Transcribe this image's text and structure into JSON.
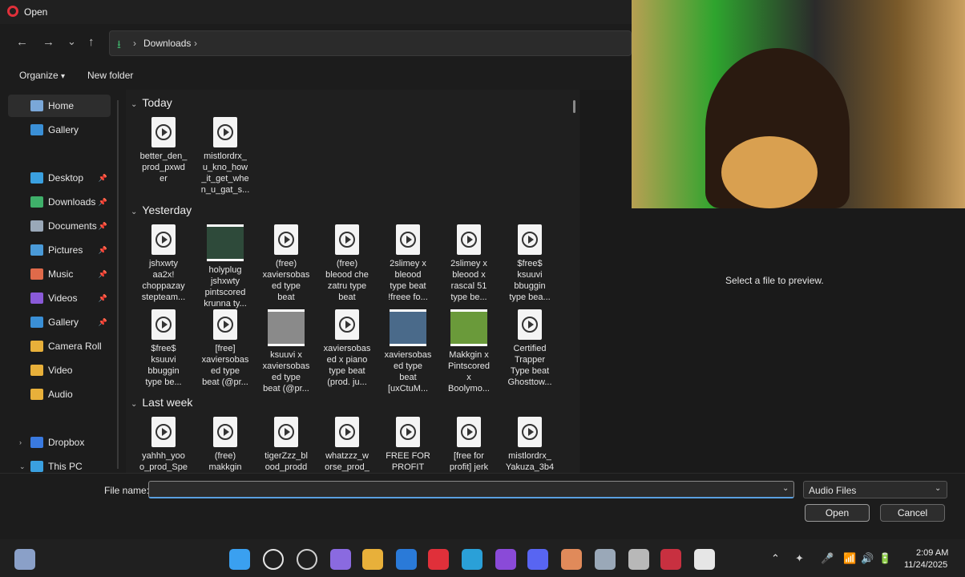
{
  "window": {
    "title": "Open"
  },
  "nav": {
    "back": "←",
    "forward": "→",
    "recent": "⌄",
    "up": "↑"
  },
  "address": {
    "crumbs": [
      "Downloads"
    ],
    "sep": "›"
  },
  "commands": {
    "organize": "Organize",
    "organize_chevron": "▾",
    "new_folder": "New folder"
  },
  "sidebar": {
    "items": [
      {
        "label": "Home",
        "icon": "home-icon",
        "color": "#7aa7d8",
        "selected": true
      },
      {
        "label": "Gallery",
        "icon": "gallery-icon",
        "color": "#3a8fd6"
      },
      {
        "label": "Desktop",
        "icon": "desktop-icon",
        "color": "#3aa0e0",
        "pinned": true
      },
      {
        "label": "Downloads",
        "icon": "download-icon",
        "color": "#3fb06a",
        "pinned": true
      },
      {
        "label": "Documents",
        "icon": "document-icon",
        "color": "#9aa8b8",
        "pinned": true
      },
      {
        "label": "Pictures",
        "icon": "pictures-icon",
        "color": "#4a9ad8",
        "pinned": true
      },
      {
        "label": "Music",
        "icon": "music-icon",
        "color": "#e06a4a",
        "pinned": true
      },
      {
        "label": "Videos",
        "icon": "videos-icon",
        "color": "#8a5ad8",
        "pinned": true
      },
      {
        "label": "Gallery",
        "icon": "gallery-icon",
        "color": "#3a8fd6",
        "pinned": true
      },
      {
        "label": "Camera Roll",
        "icon": "folder-icon",
        "color": "#e8b03a"
      },
      {
        "label": "Video",
        "icon": "folder-icon",
        "color": "#e8b03a"
      },
      {
        "label": "Audio",
        "icon": "folder-icon",
        "color": "#e8b03a"
      },
      {
        "label": "Dropbox",
        "icon": "dropbox-icon",
        "color": "#3a7ae0",
        "expandable": "›"
      },
      {
        "label": "This PC",
        "icon": "pc-icon",
        "color": "#3aa0e0",
        "expandable": "⌄"
      }
    ],
    "pin_glyph": "📌"
  },
  "groups": [
    {
      "label": "Today",
      "files": [
        {
          "name": "better_den_\nprod_pxwd\ner",
          "kind": "audio"
        },
        {
          "name": "mistlordrx_\nu_kno_how\n_it_get_whe\nn_u_gat_s...",
          "kind": "audio"
        }
      ]
    },
    {
      "label": "Yesterday",
      "files": [
        {
          "name": "jshxwty\naa2x!\nchoppazay\nstepteam...",
          "kind": "audio"
        },
        {
          "name": "holyplug\njshxwty\npintscored\nkrunna ty...",
          "kind": "thumb",
          "color": "#2e4a3a"
        },
        {
          "name": "(free)\nxaviersobas\ned type\nbeat",
          "kind": "audio"
        },
        {
          "name": "(free)\nbleood che\nzatru type\nbeat",
          "kind": "audio"
        },
        {
          "name": "2slimey x\nbleood\ntype beat\n!freee fo...",
          "kind": "audio"
        },
        {
          "name": "2slimey x\nbleood x\nrascal 51\ntype be...",
          "kind": "audio"
        },
        {
          "name": "$free$\nksuuvi\nbbuggin\ntype bea...",
          "kind": "audio"
        },
        {
          "name": "$free$\nksuuvi\nbbuggin\ntype be...",
          "kind": "audio"
        },
        {
          "name": "[free]\nxaviersobas\ned type\nbeat (@pr...",
          "kind": "audio"
        },
        {
          "name": "ksuuvi x\nxaviersobas\ned type\nbeat (@pr...",
          "kind": "thumb",
          "color": "#8a8a8a"
        },
        {
          "name": "xaviersobas\ned x piano\ntype beat\n(prod. ju...",
          "kind": "audio"
        },
        {
          "name": "xaviersobas\ned type\nbeat\n[uxCtuM...",
          "kind": "thumb",
          "color": "#4a6a8a"
        },
        {
          "name": "Makkgin x\nPintscored\nx\nBoolymo...",
          "kind": "thumb",
          "color": "#6a9a3a"
        },
        {
          "name": "Certified\nTrapper\nType beat\nGhosttow...",
          "kind": "audio"
        }
      ]
    },
    {
      "label": "Last week",
      "files": [
        {
          "name": "yahhh_yoo\no_prod_Spe",
          "kind": "audio"
        },
        {
          "name": "(free)\nmakkgin",
          "kind": "audio"
        },
        {
          "name": "tigerZzz_bl\nood_prodd",
          "kind": "audio"
        },
        {
          "name": "whatzzz_w\norse_prod_",
          "kind": "audio"
        },
        {
          "name": "FREE FOR\nPROFIT",
          "kind": "audio"
        },
        {
          "name": "[free for\nprofit] jerk",
          "kind": "audio"
        },
        {
          "name": "mistlordrx_\nYakuza_3b4",
          "kind": "audio"
        }
      ]
    }
  ],
  "preview": {
    "text": "Select a file to preview."
  },
  "footer": {
    "file_name_label": "File name:",
    "file_name_value": "",
    "filter_value": "Audio Files",
    "open_label": "Open",
    "cancel_label": "Cancel"
  },
  "taskbar": {
    "time": "2:09 AM",
    "date": "11/24/2025",
    "icons": [
      {
        "name": "weather-icon",
        "color": "#8aa0c8"
      },
      {
        "name": "start-icon",
        "color": "#3aa0f0"
      },
      {
        "name": "search-icon",
        "color": "#e6e6e6"
      },
      {
        "name": "task-view-icon",
        "color": "#cfcfcf"
      },
      {
        "name": "copilot-icon",
        "color": "#8a6ae0"
      },
      {
        "name": "file-explorer-icon",
        "color": "#e8b03a"
      },
      {
        "name": "outlook-icon",
        "color": "#2a7ad8"
      },
      {
        "name": "opera-icon",
        "color": "#e0303a"
      },
      {
        "name": "edge-icon",
        "color": "#2aa0d8"
      },
      {
        "name": "clipchamp-icon",
        "color": "#8a4ad8"
      },
      {
        "name": "discord-icon",
        "color": "#5865f2"
      },
      {
        "name": "app-icon",
        "color": "#e08a5a"
      },
      {
        "name": "camera-icon",
        "color": "#9aa8b8"
      },
      {
        "name": "record-icon",
        "color": "#b8b8b8"
      },
      {
        "name": "red-app-icon",
        "color": "#c83040"
      },
      {
        "name": "media-player-icon",
        "color": "#e6e6e6"
      }
    ]
  }
}
